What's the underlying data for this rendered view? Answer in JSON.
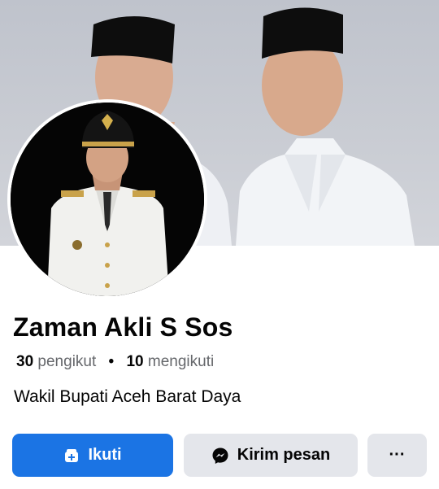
{
  "profile": {
    "name": "Zaman Akli S Sos",
    "followers_count": "30",
    "followers_label": "pengikut",
    "separator": "•",
    "following_count": "10",
    "following_label": "mengikuti",
    "bio": "Wakil Bupati Aceh Barat Daya"
  },
  "actions": {
    "follow_label": "Ikuti",
    "message_label": "Kirim pesan",
    "more_label": "···"
  },
  "icons": {
    "follow": "follow-user-icon",
    "message": "messenger-icon",
    "more": "more-dots-icon"
  },
  "colors": {
    "primary": "#1b74e4",
    "secondary_button": "#e4e6eb",
    "text": "#050505",
    "muted_text": "#65676b"
  }
}
